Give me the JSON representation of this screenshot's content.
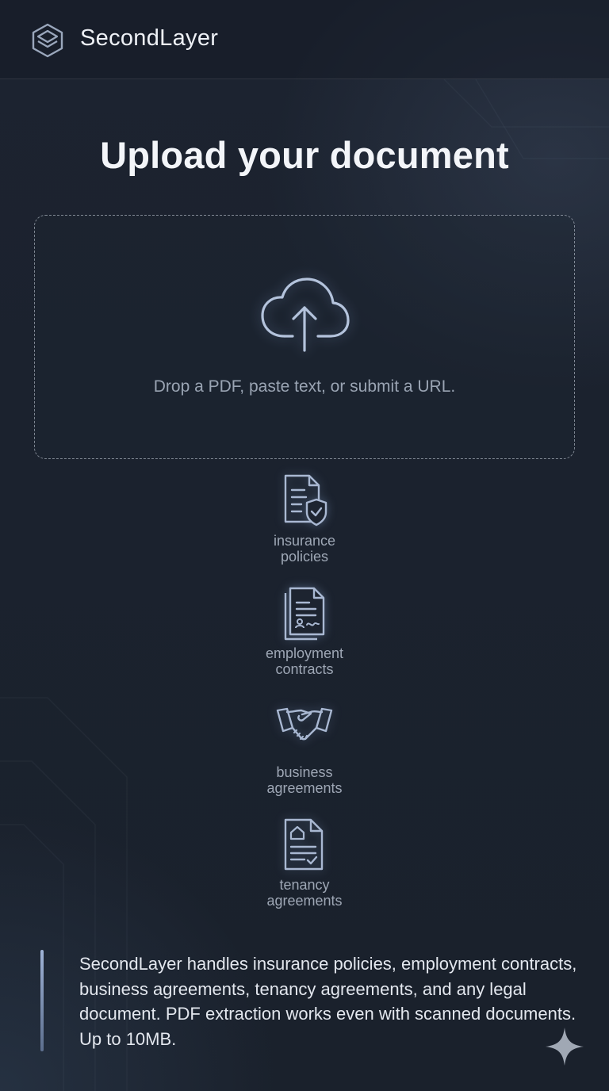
{
  "header": {
    "brand": "SecondLayer",
    "logo_icon": "stacked-layers-icon"
  },
  "main": {
    "title": "Upload your document",
    "dropzone": {
      "icon": "cloud-upload-icon",
      "hint": "Drop a PDF, paste text, or submit a URL."
    },
    "document_types": [
      {
        "label": "insurance policies",
        "icon": "document-shield-icon"
      },
      {
        "label": "employment contracts",
        "icon": "contract-signature-icon"
      },
      {
        "label": "business agreements",
        "icon": "handshake-icon"
      },
      {
        "label": "tenancy agreements",
        "icon": "house-document-icon"
      }
    ],
    "info": "SecondLayer handles insurance policies, employment contracts, business agreements, tenancy agreements, and any legal document. PDF extraction works even with scanned documents. Up to 10MB."
  },
  "corner_icon": "sparkle-icon",
  "colors": {
    "background": "#1b222e",
    "text": "#e7ebf2",
    "muted_text": "#9ea7b5",
    "icon_stroke": "#a9b8d2"
  }
}
